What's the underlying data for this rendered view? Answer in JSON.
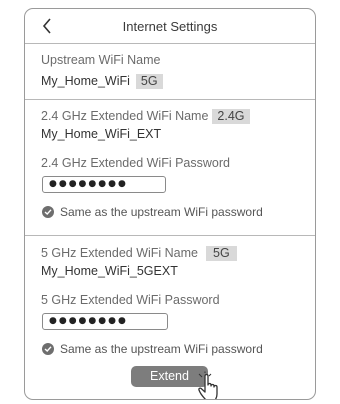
{
  "header": {
    "title": "Internet Settings",
    "back_icon": "chevron-left-icon"
  },
  "upstream": {
    "label": "Upstream WiFi Name",
    "name": "My_Home_WiFi",
    "band": "5G"
  },
  "band24": {
    "name_label": "2.4 GHz Extended WiFi Name",
    "band": "2.4G",
    "name": "My_Home_WiFi_EXT",
    "password_label": "2.4 GHz Extended WiFi Password",
    "password_mask": "●●●●●●●●",
    "same_label": "Same as the upstream WiFi password"
  },
  "band5": {
    "name_label": "5 GHz Extended WiFi Name",
    "band": "5G",
    "name": "My_Home_WiFi_5GEXT",
    "password_label": "5 GHz Extended WiFi Password",
    "password_mask": "●●●●●●●●",
    "same_label": "Same as the upstream WiFi password"
  },
  "actions": {
    "extend_label": "Extend",
    "cursor_icon": "hand-pointer-icon"
  },
  "colors": {
    "button": "#7d7d7d",
    "badge": "#d9d9d9",
    "check": "#6e6e6e"
  }
}
